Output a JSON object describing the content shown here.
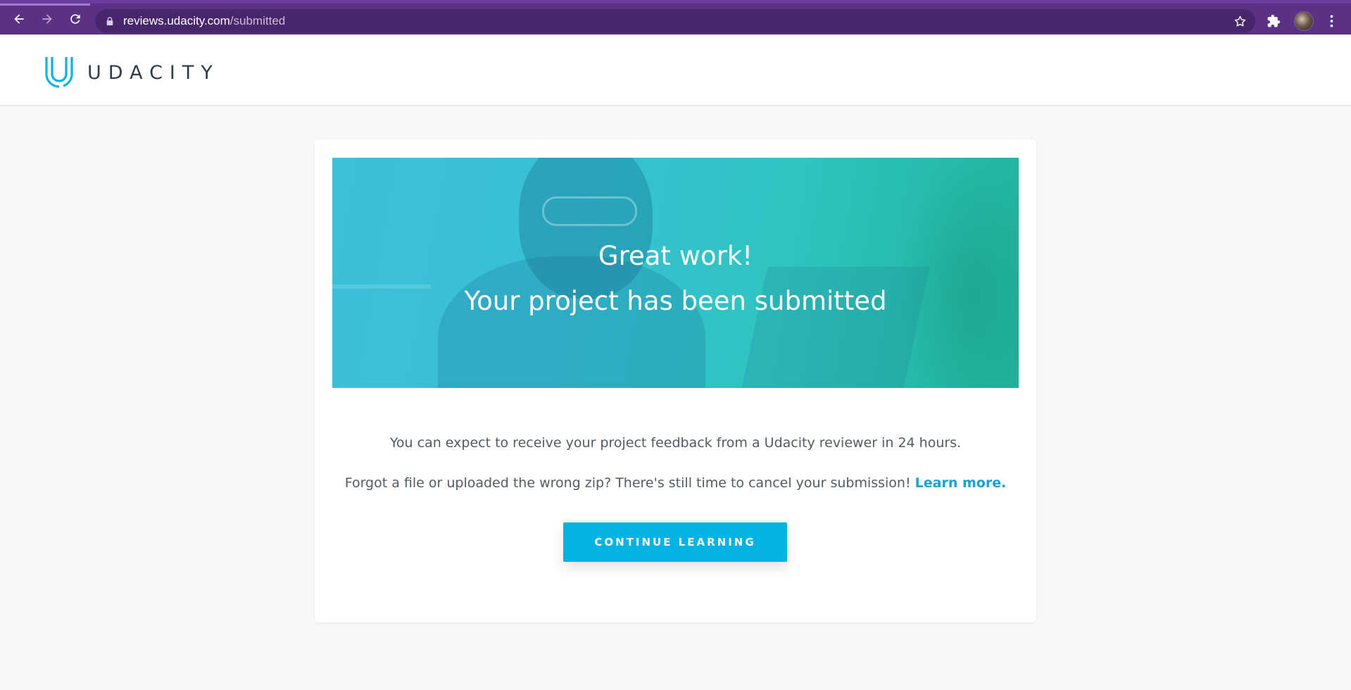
{
  "browser": {
    "url_host": "reviews.udacity.com",
    "url_path": "/submitted"
  },
  "header": {
    "logo_text": "UDACITY"
  },
  "hero": {
    "title": "Great work!",
    "subtitle": "Your project has been submitted"
  },
  "body": {
    "feedback_text": "You can expect to receive your project feedback from a Udacity reviewer in 24 hours.",
    "cancel_text": "Forgot a file or uploaded the wrong zip? There's still time to cancel your submission! ",
    "learn_more_label": "Learn more."
  },
  "actions": {
    "continue_label": "CONTINUE LEARNING"
  },
  "colors": {
    "browser_chrome": "#5a3185",
    "accent": "#02b3e4",
    "link": "#15a2d5",
    "text": "#4f5b66"
  },
  "icons": {
    "back": "arrow-left",
    "forward": "arrow-right",
    "reload": "reload",
    "lock": "lock",
    "bookmark": "star",
    "extensions": "puzzle",
    "menu": "kebab-vertical"
  }
}
